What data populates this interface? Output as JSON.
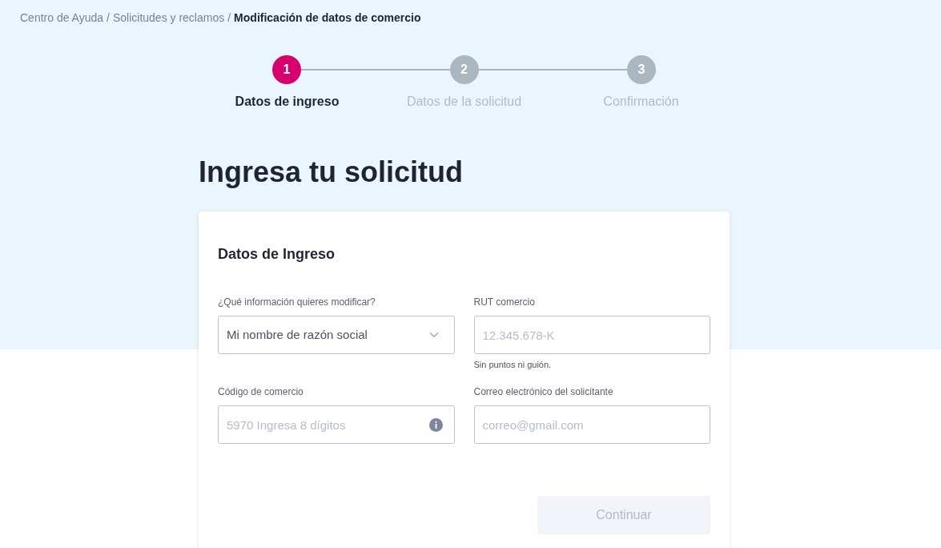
{
  "breadcrumb": [
    {
      "label": "Centro de Ayuda",
      "current": false
    },
    {
      "label": "Solicitudes y reclamos",
      "current": false
    },
    {
      "label": "Modificación de datos de comercio",
      "current": true
    }
  ],
  "separator": "/",
  "steps": [
    {
      "number": "1",
      "label": "Datos de ingreso",
      "selected": true
    },
    {
      "number": "2",
      "label": "Datos de la solicitud",
      "selected": false
    },
    {
      "number": "3",
      "label": "Confirmación",
      "selected": false
    }
  ],
  "title": "Ingresa tu solicitud",
  "form": {
    "title": "Datos de Ingreso",
    "fields": [
      {
        "kind": "select",
        "label": "¿Qué información quieres modificar?",
        "value": "Mi nombre de razón social"
      },
      {
        "kind": "input",
        "label": "RUT comercio",
        "placeholder": "12.345.678-K",
        "hint": "Sin puntos ni guión."
      },
      {
        "kind": "info",
        "label": "Código de comercio",
        "placeholder": "5970 Ingresa 8 dígitos"
      },
      {
        "kind": "input",
        "label": "Correo electrónico del solicitante",
        "placeholder": "correo@gmail.com"
      }
    ],
    "button": {
      "label": "Continuar",
      "disabled": true
    }
  }
}
